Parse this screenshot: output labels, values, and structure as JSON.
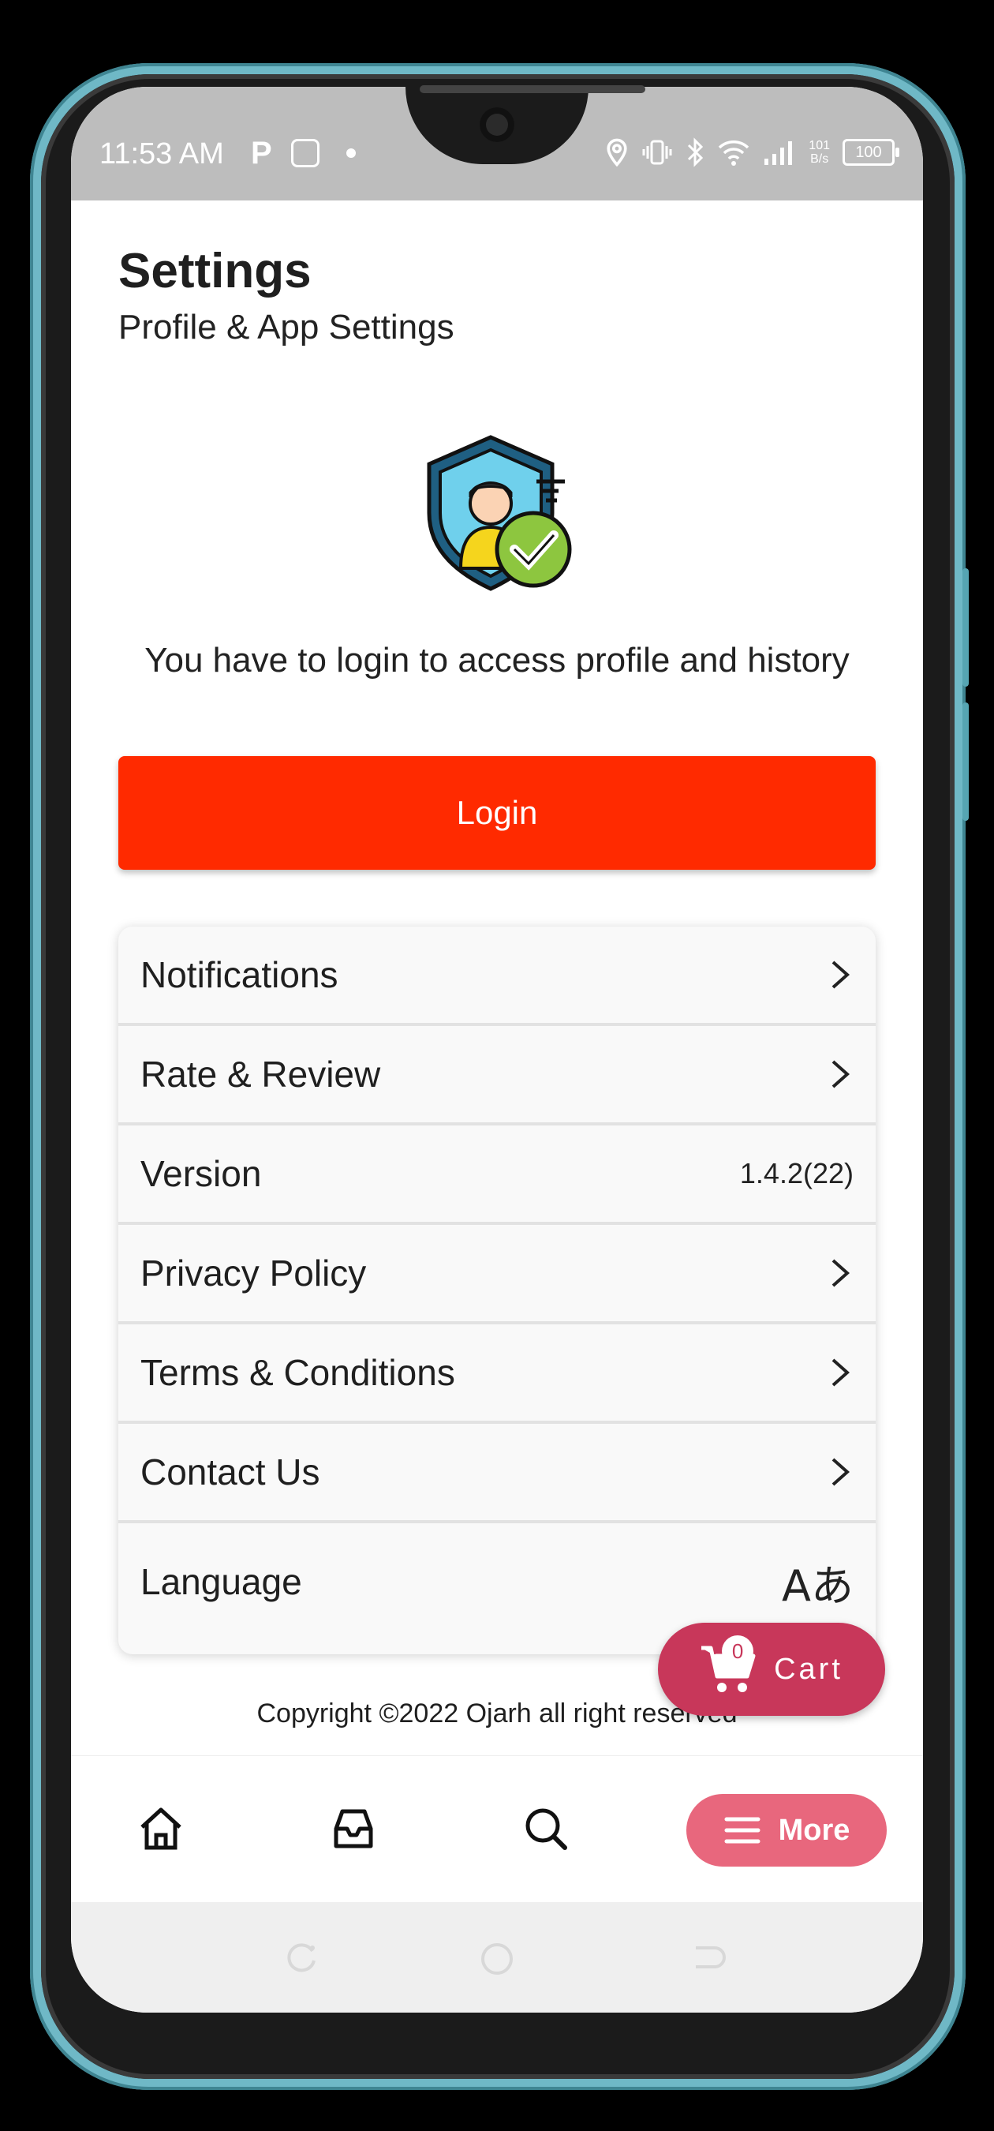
{
  "status_bar": {
    "time": "11:53 AM",
    "left_icons": [
      "parking-icon",
      "app-icon",
      "dot-icon"
    ],
    "right_icons": [
      "location-icon",
      "vibrate-icon",
      "bluetooth-icon",
      "wifi-icon",
      "signal-icon"
    ],
    "net_speed_value": "101",
    "net_speed_unit": "B/s",
    "battery": "100"
  },
  "header": {
    "title": "Settings",
    "subtitle": "Profile & App Settings"
  },
  "login": {
    "message": "You have to login to access profile and history",
    "button_label": "Login"
  },
  "settings": [
    {
      "label": "Notifications",
      "trailing": "chevron-right-icon"
    },
    {
      "label": "Rate & Review",
      "trailing": "chevron-right-icon"
    },
    {
      "label": "Version",
      "value": "1.4.2(22)"
    },
    {
      "label": "Privacy Policy",
      "trailing": "chevron-right-icon"
    },
    {
      "label": "Terms & Conditions",
      "trailing": "chevron-right-icon"
    },
    {
      "label": "Contact Us",
      "trailing": "chevron-right-icon"
    },
    {
      "label": "Language",
      "trailing": "translate-icon",
      "icon_glyph": "Aあ"
    }
  ],
  "copyright": "Copyright ©2022 Ojarh all right reserved",
  "cart": {
    "label": "Cart",
    "count": "0"
  },
  "bottom_nav": {
    "items": [
      "home-icon",
      "inbox-icon",
      "search-icon"
    ],
    "more_label": "More"
  },
  "colors": {
    "primary": "#ff2a00",
    "cart": "#c8375a",
    "more": "#e8677d",
    "status_bar": "#bdbdbd"
  }
}
